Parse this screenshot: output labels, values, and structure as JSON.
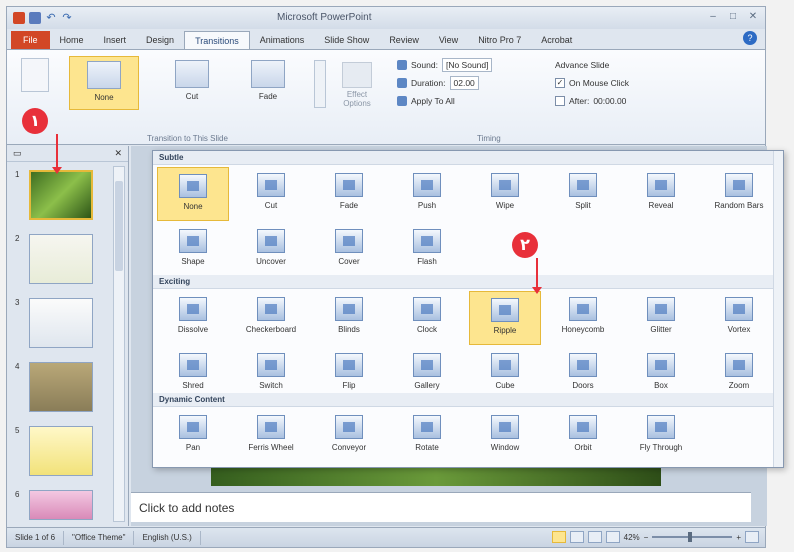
{
  "window": {
    "title": "Microsoft PowerPoint",
    "controls": [
      "minimize",
      "maximize",
      "close"
    ]
  },
  "tabs": [
    "File",
    "Home",
    "Insert",
    "Design",
    "Transitions",
    "Animations",
    "Slide Show",
    "Review",
    "View",
    "Nitro Pro 7",
    "Acrobat"
  ],
  "active_tab": "Transitions",
  "ribbon": {
    "gallery": [
      {
        "label": "None",
        "selected": true
      },
      {
        "label": "Cut",
        "selected": false
      },
      {
        "label": "Fade",
        "selected": false
      }
    ],
    "effect_options": "Effect Options",
    "group_label": "Transition to This Slide",
    "timing": {
      "sound_label": "Sound:",
      "sound_value": "[No Sound]",
      "duration_label": "Duration:",
      "duration_value": "02.00",
      "apply_all": "Apply To All",
      "group_label": "Timing"
    },
    "advance": {
      "title": "Advance Slide",
      "on_click": "On Mouse Click",
      "on_click_checked": true,
      "after": "After:",
      "after_value": "00:00.00",
      "after_checked": false
    }
  },
  "slides": {
    "numbers": [
      "1",
      "2",
      "3",
      "4",
      "5",
      "6"
    ],
    "selected": 1
  },
  "notes_placeholder": "Click to add notes",
  "gallery": {
    "sections": [
      {
        "title": "Subtle",
        "items": [
          "None",
          "Cut",
          "Fade",
          "Push",
          "Wipe",
          "Split",
          "Reveal",
          "Random Bars",
          "Shape",
          "Uncover",
          "Cover",
          "Flash"
        ]
      },
      {
        "title": "Exciting",
        "items": [
          "Dissolve",
          "Checkerboard",
          "Blinds",
          "Clock",
          "Ripple",
          "Honeycomb",
          "Glitter",
          "Vortex",
          "Shred",
          "Switch",
          "Flip",
          "Gallery",
          "Cube",
          "Doors",
          "Box",
          "Zoom"
        ]
      },
      {
        "title": "Dynamic Content",
        "items": [
          "Pan",
          "Ferris Wheel",
          "Conveyor",
          "Rotate",
          "Window",
          "Orbit",
          "Fly Through"
        ]
      }
    ],
    "selected": [
      "None",
      "Ripple"
    ]
  },
  "callouts": [
    "۱",
    "۲"
  ],
  "statusbar": {
    "slide_info": "Slide 1 of 6",
    "theme": "\"Office Theme\"",
    "language": "English (U.S.)",
    "zoom": "42%"
  },
  "colors": {
    "accent_selected": "#fde58f",
    "file_tab": "#d24726",
    "callout": "#e8303a"
  }
}
